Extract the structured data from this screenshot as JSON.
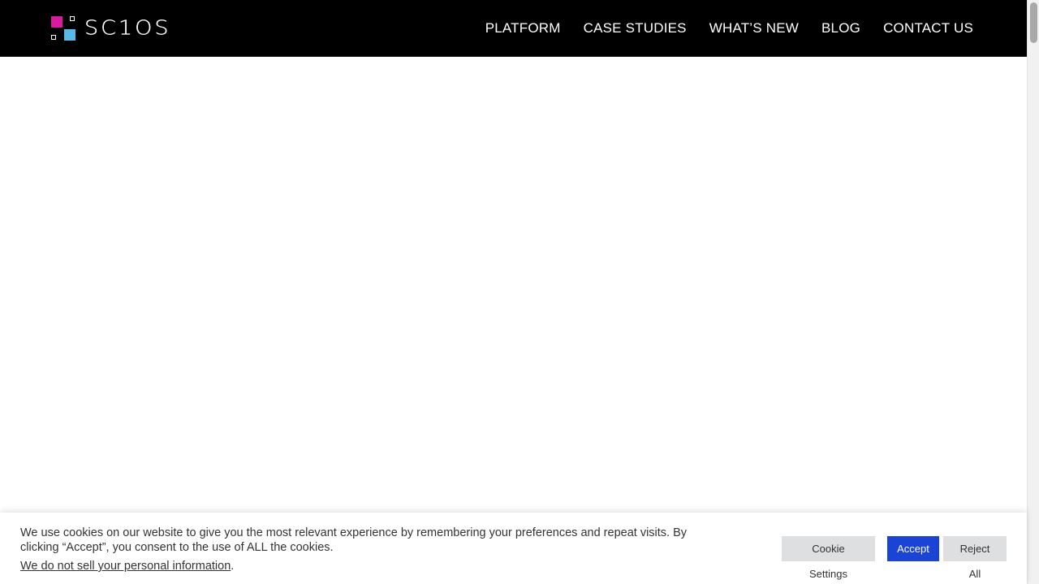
{
  "header": {
    "logo_text": "SC1OS",
    "nav": [
      {
        "label": "PLATFORM"
      },
      {
        "label": "CASE STUDIES"
      },
      {
        "label": "WHAT’S NEW"
      },
      {
        "label": "BLOG"
      },
      {
        "label": "CONTACT US"
      }
    ]
  },
  "cookie_banner": {
    "message": "We use cookies on our website to give you the most relevant experience by remembering your preferences and repeat visits. By clicking “Accept”, you consent to the use of ALL the cookies.",
    "link_text": "We do not sell your personal information",
    "link_suffix": ".",
    "settings_label": "Cookie Settings",
    "accept_label": "Accept",
    "reject_label": "Reject All"
  },
  "colors": {
    "header_bg": "#000000",
    "logo_magenta": "#d81b9f",
    "logo_blue": "#58b8e8",
    "accept_bg": "#1a44d6",
    "secondary_button_bg": "#dedfe0"
  }
}
